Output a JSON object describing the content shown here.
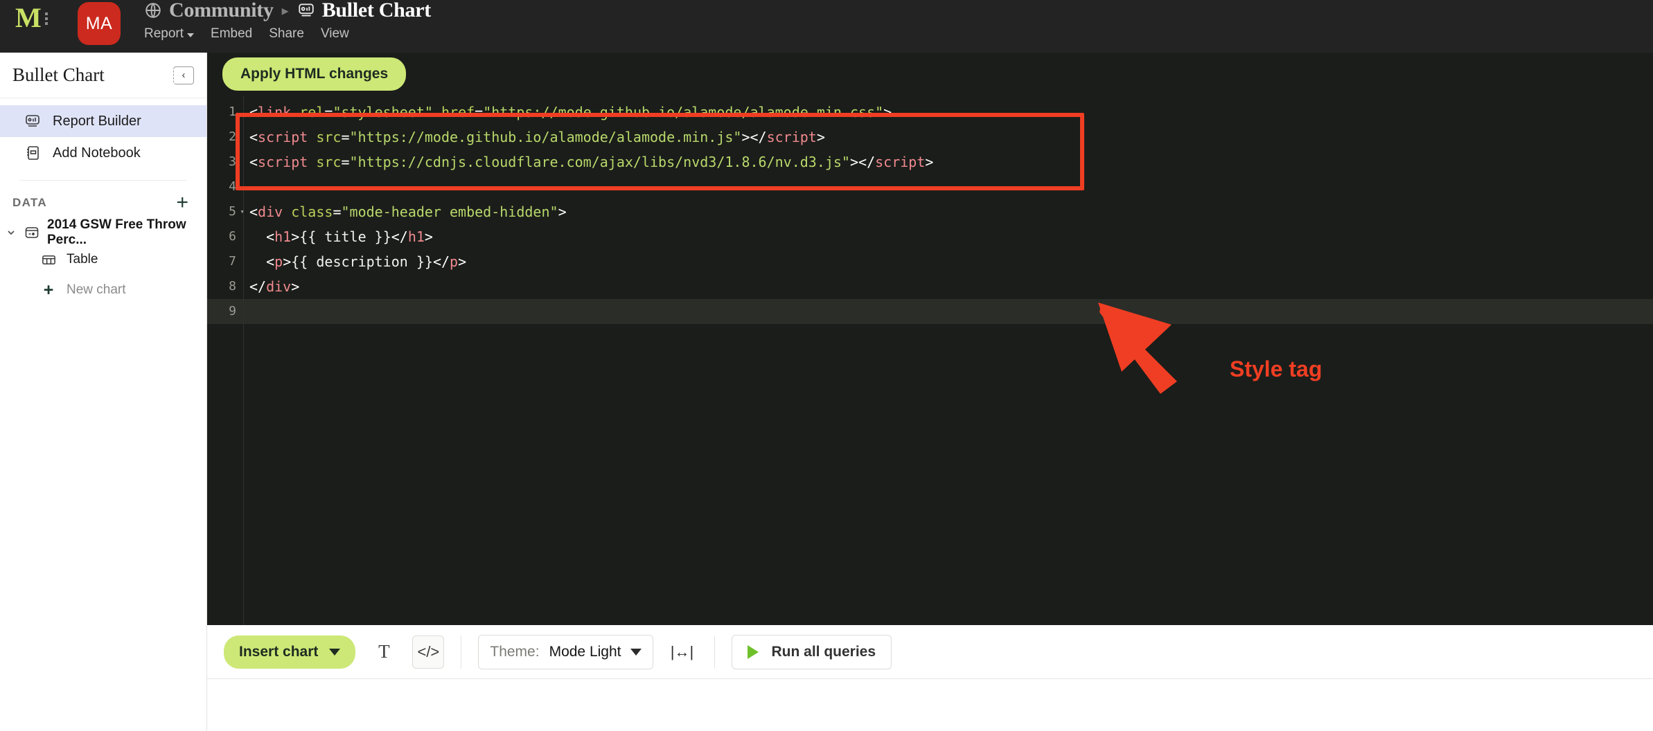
{
  "topbar": {
    "logo": "M",
    "avatar_initials": "MA",
    "breadcrumb": {
      "workspace": "Community",
      "separator": "▸",
      "page": "Bullet Chart"
    },
    "nav": [
      {
        "label": "Report",
        "has_caret": true
      },
      {
        "label": "Embed",
        "has_caret": false
      },
      {
        "label": "Share",
        "has_caret": false
      },
      {
        "label": "View",
        "has_caret": false
      }
    ]
  },
  "sidebar": {
    "title": "Bullet Chart",
    "collapse_icon": "‹",
    "items": [
      {
        "label": "Report Builder",
        "icon": "bullet-chart-icon",
        "active": true
      },
      {
        "label": "Add Notebook",
        "icon": "notebook-icon",
        "active": false
      }
    ],
    "data_section": {
      "label": "DATA",
      "add_label": "+",
      "dataset": {
        "name": "2014 GSW Free Throw Perc...",
        "expanded": true,
        "children": [
          {
            "label": "Table",
            "icon": "table-icon"
          },
          {
            "label": "New chart",
            "icon": "plus-icon"
          }
        ]
      }
    }
  },
  "editor": {
    "apply_button": "Apply HTML changes",
    "active_line": 9,
    "lines": [
      {
        "n": 1,
        "tokens": [
          {
            "t": "punct",
            "v": "<"
          },
          {
            "t": "tag",
            "v": "link"
          },
          {
            "t": "txt",
            "v": " "
          },
          {
            "t": "attr",
            "v": "rel"
          },
          {
            "t": "punct",
            "v": "="
          },
          {
            "t": "str",
            "v": "\"stylesheet\""
          },
          {
            "t": "txt",
            "v": " "
          },
          {
            "t": "attr",
            "v": "href"
          },
          {
            "t": "punct",
            "v": "="
          },
          {
            "t": "str",
            "v": "\"https://mode.github.io/alamode/alamode.min.css\""
          },
          {
            "t": "punct",
            "v": ">"
          }
        ]
      },
      {
        "n": 2,
        "tokens": [
          {
            "t": "punct",
            "v": "<"
          },
          {
            "t": "tag",
            "v": "script"
          },
          {
            "t": "txt",
            "v": " "
          },
          {
            "t": "attr",
            "v": "src"
          },
          {
            "t": "punct",
            "v": "="
          },
          {
            "t": "str",
            "v": "\"https://mode.github.io/alamode/alamode.min.js\""
          },
          {
            "t": "punct",
            "v": "></"
          },
          {
            "t": "tag",
            "v": "script"
          },
          {
            "t": "punct",
            "v": ">"
          }
        ]
      },
      {
        "n": 3,
        "tokens": [
          {
            "t": "punct",
            "v": "<"
          },
          {
            "t": "tag",
            "v": "script"
          },
          {
            "t": "txt",
            "v": " "
          },
          {
            "t": "attr",
            "v": "src"
          },
          {
            "t": "punct",
            "v": "="
          },
          {
            "t": "str",
            "v": "\"https://cdnjs.cloudflare.com/ajax/libs/nvd3/1.8.6/nv.d3.js\""
          },
          {
            "t": "punct",
            "v": "></"
          },
          {
            "t": "tag",
            "v": "script"
          },
          {
            "t": "punct",
            "v": ">"
          }
        ]
      },
      {
        "n": 4,
        "tokens": []
      },
      {
        "n": 5,
        "fold": true,
        "tokens": [
          {
            "t": "punct",
            "v": "<"
          },
          {
            "t": "tag",
            "v": "div"
          },
          {
            "t": "txt",
            "v": " "
          },
          {
            "t": "attr",
            "v": "class"
          },
          {
            "t": "punct",
            "v": "="
          },
          {
            "t": "str",
            "v": "\"mode-header embed-hidden\""
          },
          {
            "t": "punct",
            "v": ">"
          }
        ]
      },
      {
        "n": 6,
        "tokens": [
          {
            "t": "txt",
            "v": "  "
          },
          {
            "t": "punct",
            "v": "<"
          },
          {
            "t": "tag",
            "v": "h1"
          },
          {
            "t": "punct",
            "v": ">"
          },
          {
            "t": "txt",
            "v": "{{ title }}"
          },
          {
            "t": "punct",
            "v": "</"
          },
          {
            "t": "tag",
            "v": "h1"
          },
          {
            "t": "punct",
            "v": ">"
          }
        ]
      },
      {
        "n": 7,
        "tokens": [
          {
            "t": "txt",
            "v": "  "
          },
          {
            "t": "punct",
            "v": "<"
          },
          {
            "t": "tag",
            "v": "p"
          },
          {
            "t": "punct",
            "v": ">"
          },
          {
            "t": "txt",
            "v": "{{ description }}"
          },
          {
            "t": "punct",
            "v": "</"
          },
          {
            "t": "tag",
            "v": "p"
          },
          {
            "t": "punct",
            "v": ">"
          }
        ]
      },
      {
        "n": 8,
        "tokens": [
          {
            "t": "punct",
            "v": "</"
          },
          {
            "t": "tag",
            "v": "div"
          },
          {
            "t": "punct",
            "v": ">"
          }
        ]
      },
      {
        "n": 9,
        "tokens": []
      }
    ]
  },
  "annotation": {
    "label": "Style tag",
    "color": "#ef3e23",
    "highlight_lines": [
      1,
      2,
      3
    ]
  },
  "toolbar": {
    "insert_chart": "Insert chart",
    "text_icon": "T",
    "code_icon": "</>",
    "theme_label": "Theme:",
    "theme_value": "Mode Light",
    "fit_icon": "|↔|",
    "run_label": "Run all queries"
  },
  "colors": {
    "accent_green": "#cde876",
    "annotation_red": "#ef3e23",
    "avatar_red": "#cc2a1e",
    "editor_bg": "#1b1d1a",
    "active_item_bg": "#dfe3f7"
  }
}
